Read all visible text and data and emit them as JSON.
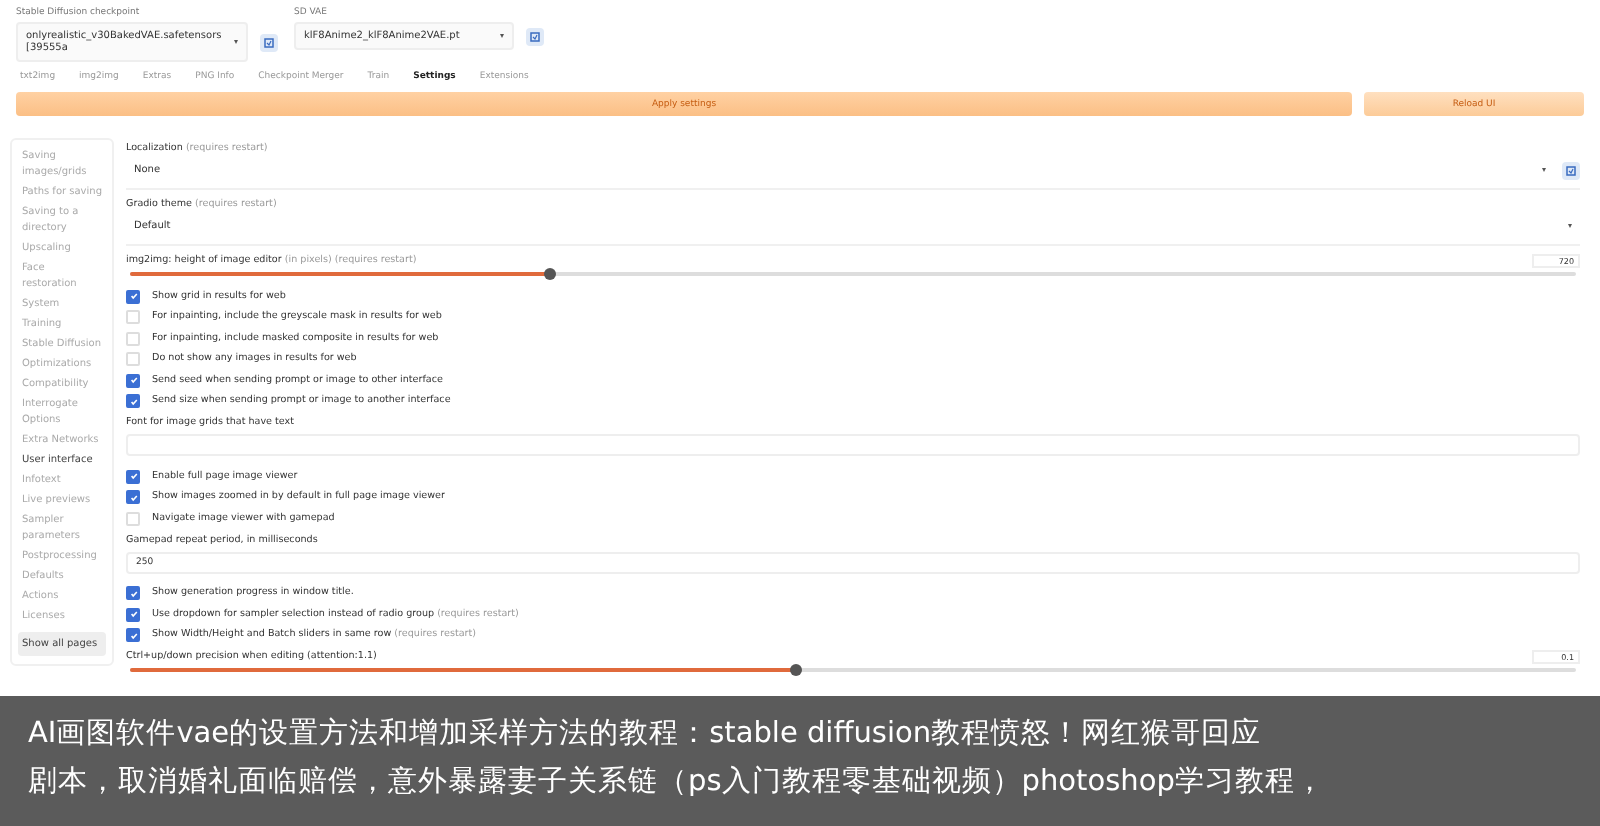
{
  "top_bar": {
    "checkpoint": {
      "label": "Stable Diffusion checkpoint",
      "value": "onlyrealistic_v30BakedVAE.safetensors [39555a"
    },
    "vae": {
      "label": "SD VAE",
      "value": "klF8Anime2_klF8Anime2VAE.pt"
    }
  },
  "tabs": [
    {
      "label": "txt2img",
      "selected": false
    },
    {
      "label": "img2img",
      "selected": false
    },
    {
      "label": "Extras",
      "selected": false
    },
    {
      "label": "PNG Info",
      "selected": false
    },
    {
      "label": "Checkpoint Merger",
      "selected": false
    },
    {
      "label": "Train",
      "selected": false
    },
    {
      "label": "Settings",
      "selected": true
    },
    {
      "label": "Extensions",
      "selected": false
    }
  ],
  "actions": {
    "apply": "Apply settings",
    "reload": "Reload UI"
  },
  "sidebar": {
    "items": [
      {
        "label": "Saving images/grids",
        "selected": false
      },
      {
        "label": "Paths for saving",
        "selected": false
      },
      {
        "label": "Saving to a directory",
        "selected": false
      },
      {
        "label": "Upscaling",
        "selected": false
      },
      {
        "label": "Face restoration",
        "selected": false
      },
      {
        "label": "System",
        "selected": false
      },
      {
        "label": "Training",
        "selected": false
      },
      {
        "label": "Stable Diffusion",
        "selected": false
      },
      {
        "label": "Optimizations",
        "selected": false
      },
      {
        "label": "Compatibility",
        "selected": false
      },
      {
        "label": "Interrogate Options",
        "selected": false
      },
      {
        "label": "Extra Networks",
        "selected": false
      },
      {
        "label": "User interface",
        "selected": true
      },
      {
        "label": "Infotext",
        "selected": false
      },
      {
        "label": "Live previews",
        "selected": false
      },
      {
        "label": "Sampler parameters",
        "selected": false
      },
      {
        "label": "Postprocessing",
        "selected": false
      },
      {
        "label": "Defaults",
        "selected": false
      },
      {
        "label": "Actions",
        "selected": false
      },
      {
        "label": "Licenses",
        "selected": false
      }
    ],
    "show_all": "Show all pages"
  },
  "settings": [
    {
      "kind": "dropdown",
      "label": "Localization",
      "note": "(requires restart)",
      "value": "None",
      "refresh": true
    },
    {
      "kind": "dropdown",
      "label": "Gradio theme",
      "note": "(requires restart)",
      "value": "Default"
    },
    {
      "kind": "slider",
      "label": "img2img: height of image editor",
      "note": "(in pixels) (requires restart)",
      "value": "720",
      "level": 0.29
    },
    {
      "kind": "checkbox",
      "label": "Show grid in results for web",
      "checked": true
    },
    {
      "kind": "checkbox",
      "label": "For inpainting, include the greyscale mask in results for web",
      "checked": false
    },
    {
      "kind": "checkbox",
      "label": "For inpainting, include masked composite in results for web",
      "checked": false
    },
    {
      "kind": "checkbox",
      "label": "Do not show any images in results for web",
      "checked": false
    },
    {
      "kind": "checkbox",
      "label": "Send seed when sending prompt or image to other interface",
      "checked": true
    },
    {
      "kind": "checkbox",
      "label": "Send size when sending prompt or image to another interface",
      "checked": true
    },
    {
      "kind": "text",
      "label": "Font for image grids that have text"
    },
    {
      "kind": "checkbox",
      "label": "Enable full page image viewer",
      "checked": true
    },
    {
      "kind": "checkbox",
      "label": "Show images zoomed in by default in full page image viewer",
      "checked": true
    },
    {
      "kind": "checkbox",
      "label": "Navigate image viewer with gamepad",
      "checked": false
    },
    {
      "kind": "text",
      "label": "Gamepad repeat period, in milliseconds",
      "value": "250"
    },
    {
      "kind": "checkbox",
      "label": "Show generation progress in window title.",
      "checked": true
    },
    {
      "kind": "checkbox",
      "label": "Use dropdown for sampler selection instead of radio group",
      "note": "(requires restart)",
      "checked": true
    },
    {
      "kind": "checkbox",
      "label": "Show Width/Height and Batch sliders in same row",
      "note": "(requires restart)",
      "checked": true
    },
    {
      "kind": "slider",
      "label": "Ctrl+up/down precision when editing (attention:1.1)",
      "value": "0.1",
      "level": 0.46
    }
  ],
  "caption": {
    "lines": [
      "AI画图软件vae的设置方法和增加采样方法的教程：stable diffusion教程愤怒！网红猴哥回应",
      "剧本，取消婚礼面临赔偿，意外暴露妻子关系链（ps入门教程零基础视频）photoshop学习教程，"
    ]
  }
}
